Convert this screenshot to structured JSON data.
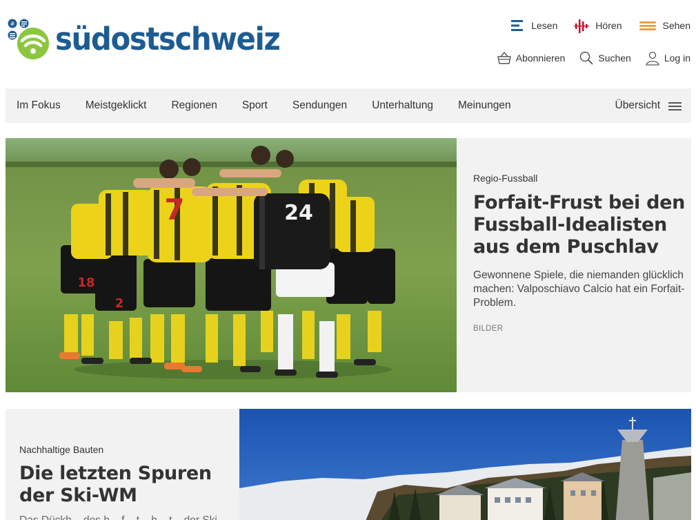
{
  "brand": {
    "name": "südostschweiz"
  },
  "top_nav": [
    {
      "label": "Lesen",
      "icon": "read-icon"
    },
    {
      "label": "Hören",
      "icon": "listen-icon"
    },
    {
      "label": "Sehen",
      "icon": "watch-icon"
    }
  ],
  "util_nav": [
    {
      "label": "Abonnieren",
      "icon": "basket-icon"
    },
    {
      "label": "Suchen",
      "icon": "search-icon"
    },
    {
      "label": "Log in",
      "icon": "user-icon"
    }
  ],
  "main_nav": {
    "items": [
      "Im Fokus",
      "Meistgeklickt",
      "Regionen",
      "Sport",
      "Sendungen",
      "Unterhaltung",
      "Meinungen"
    ],
    "overview_label": "Übersicht"
  },
  "teaser1": {
    "kicker": "Regio-Fussball",
    "headline_lines": [
      "Forfait-Frust bei den",
      "Fussball-Idealisten",
      "aus dem Puschlav"
    ],
    "lead": "Gewonnene Spiele, die niemanden glücklich machen: Valposchiavo Calcio hat ein Forfait-Problem.",
    "tag": "BILDER",
    "jersey_numbers": [
      "18",
      "2",
      "7",
      "24"
    ]
  },
  "teaser2": {
    "kicker": "Nachhaltige Bauten",
    "headline_lines": [
      "Die letzten Spuren",
      "der Ski-WM"
    ],
    "lead_partial": "Das Dückh... des h... f... t... h... t... der Ski-WM..."
  },
  "colors": {
    "brand_blue": "#1d5c92",
    "brand_green": "#8cc63f",
    "nav_bg": "#f2f2f2",
    "listen_red": "#c8102e",
    "watch_orange": "#e8a33d"
  }
}
